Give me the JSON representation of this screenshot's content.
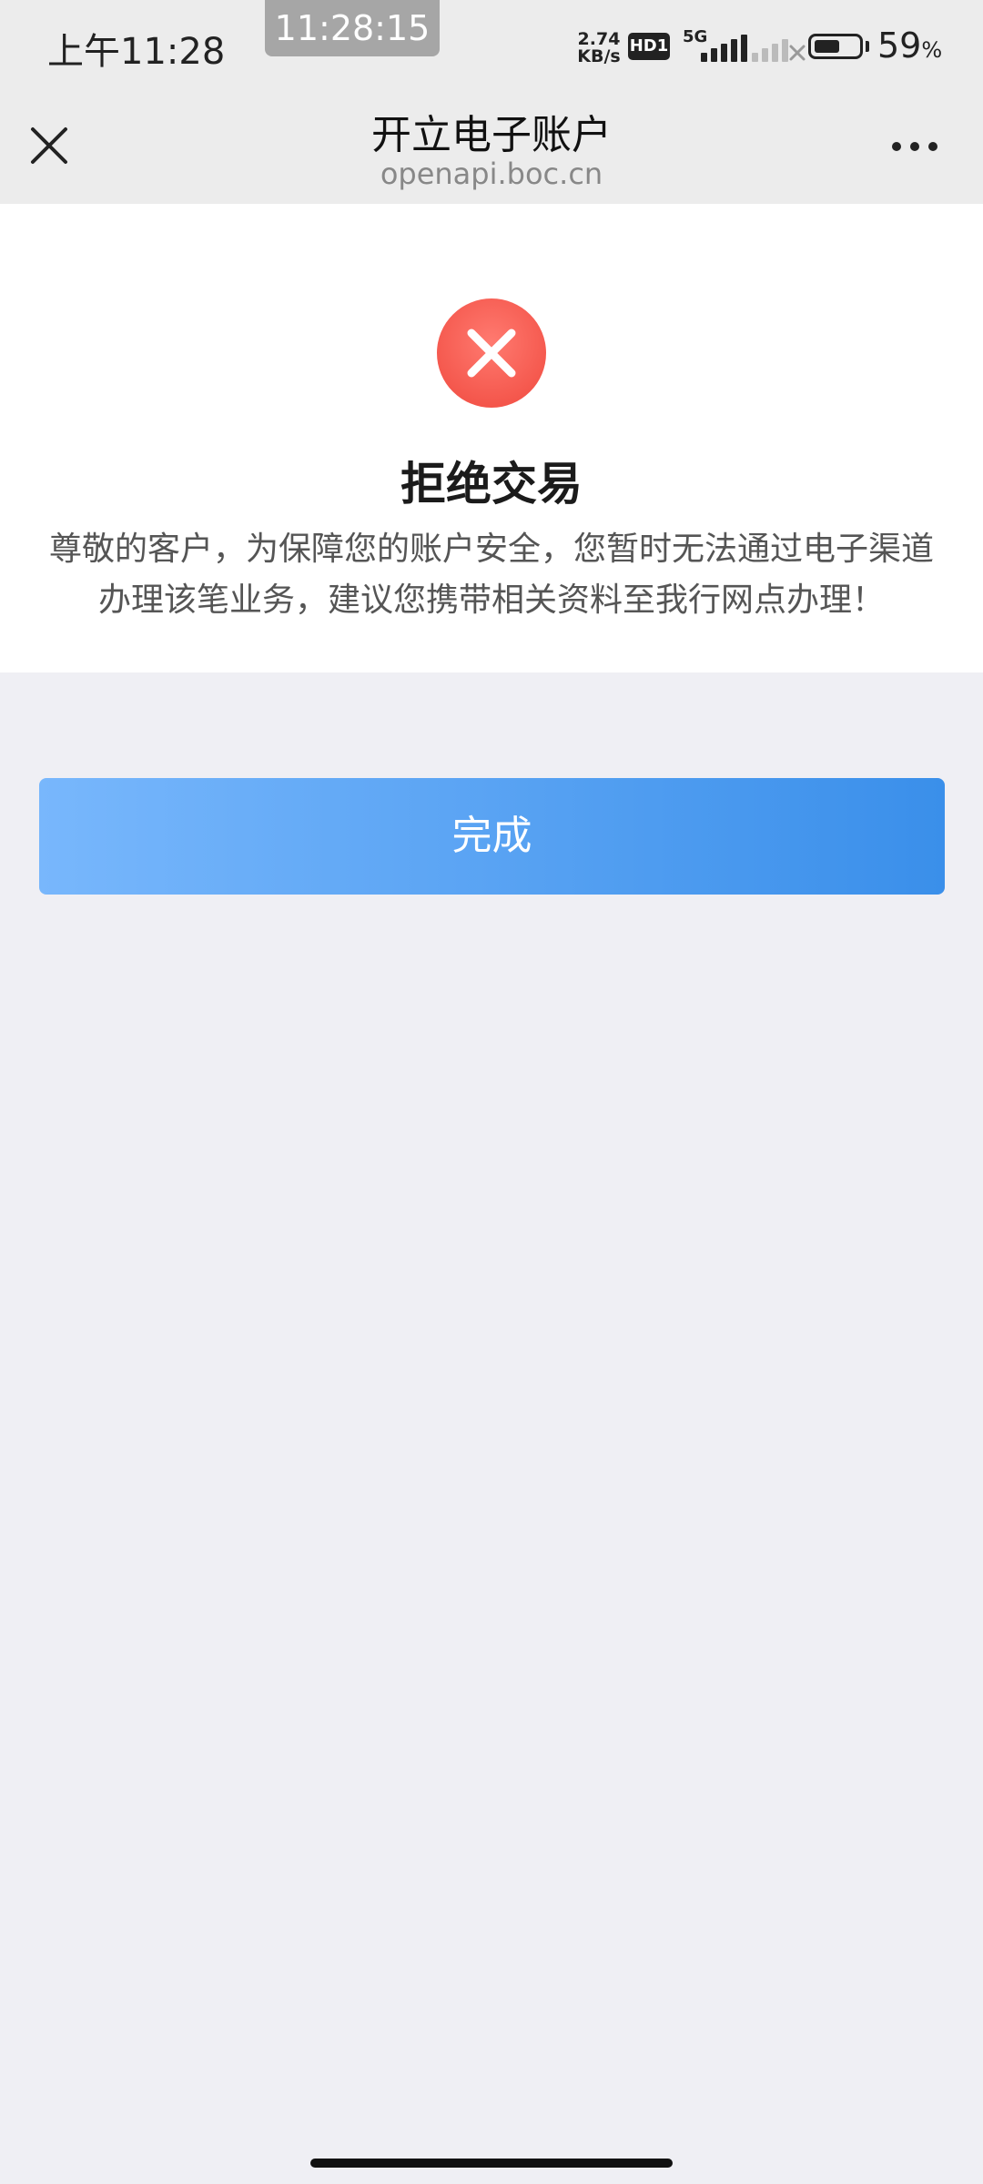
{
  "status_bar": {
    "time": "上午11:28",
    "floating_clock": "11:28:15",
    "net_speed_value": "2.74",
    "net_speed_unit": "KB/s",
    "hd_badge": "HD1",
    "network_type": "5G",
    "battery_percent": "59",
    "battery_percent_sign": "%",
    "battery_level": 0.59
  },
  "header": {
    "title": "开立电子账户",
    "url": "openapi.boc.cn"
  },
  "result": {
    "title": "拒绝交易",
    "message": "尊敬的客户，为保障您的账户安全，您暂时无法通过电子渠道办理该笔业务，建议您携带相关资料至我行网点办理！"
  },
  "actions": {
    "done_label": "完成"
  },
  "colors": {
    "error_red": "#f0493e",
    "button_gradient_start": "#78b7fc",
    "button_gradient_end": "#3a8fea",
    "page_background": "#efeff4"
  }
}
